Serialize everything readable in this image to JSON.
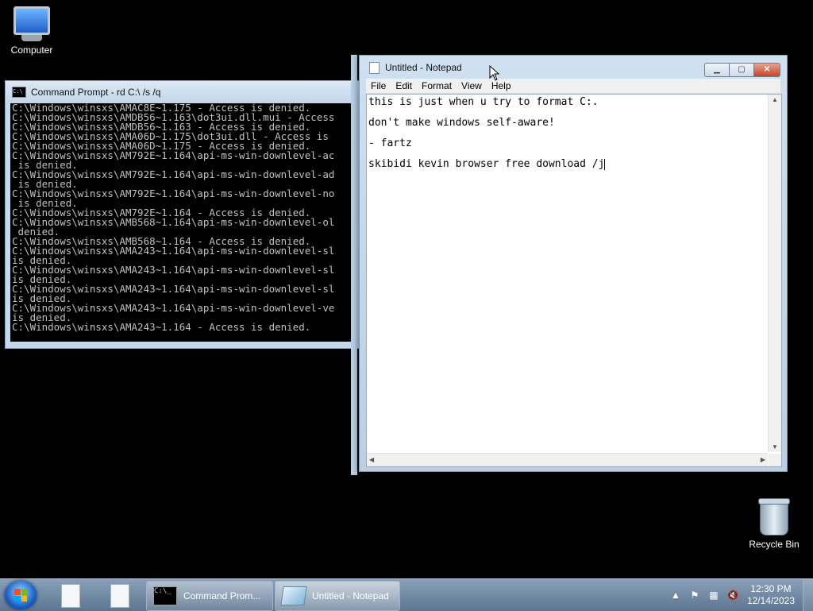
{
  "desktop": {
    "icons": [
      {
        "label": "Computer"
      },
      {
        "label": "Recycle Bin"
      }
    ]
  },
  "cmd": {
    "title": "Command Prompt - rd  C:\\ /s /q",
    "lines": [
      "C:\\Windows\\winsxs\\AMAC8E~1.175 - Access is denied.",
      "C:\\Windows\\winsxs\\AMDB56~1.163\\dot3ui.dll.mui - Access",
      "C:\\Windows\\winsxs\\AMDB56~1.163 - Access is denied.",
      "C:\\Windows\\winsxs\\AMA06D~1.175\\dot3ui.dll - Access is",
      "C:\\Windows\\winsxs\\AMA06D~1.175 - Access is denied.",
      "C:\\Windows\\winsxs\\AM792E~1.164\\api-ms-win-downlevel-ac",
      " is denied.",
      "C:\\Windows\\winsxs\\AM792E~1.164\\api-ms-win-downlevel-ad",
      " is denied.",
      "C:\\Windows\\winsxs\\AM792E~1.164\\api-ms-win-downlevel-no",
      " is denied.",
      "C:\\Windows\\winsxs\\AM792E~1.164 - Access is denied.",
      "C:\\Windows\\winsxs\\AMB568~1.164\\api-ms-win-downlevel-ol",
      " denied.",
      "C:\\Windows\\winsxs\\AMB568~1.164 - Access is denied.",
      "C:\\Windows\\winsxs\\AMA243~1.164\\api-ms-win-downlevel-sl",
      "is denied.",
      "C:\\Windows\\winsxs\\AMA243~1.164\\api-ms-win-downlevel-sl",
      "is denied.",
      "C:\\Windows\\winsxs\\AMA243~1.164\\api-ms-win-downlevel-sl",
      "is denied.",
      "C:\\Windows\\winsxs\\AMA243~1.164\\api-ms-win-downlevel-ve",
      "is denied.",
      "C:\\Windows\\winsxs\\AMA243~1.164 - Access is denied."
    ]
  },
  "notepad": {
    "title": "Untitled - Notepad",
    "menu": [
      "File",
      "Edit",
      "Format",
      "View",
      "Help"
    ],
    "lines": [
      "this is just when u try to format C:.",
      "don't make windows self-aware!",
      "- fartz",
      "skibidi kevin browser free download /j"
    ]
  },
  "taskbar": {
    "buttons": [
      {
        "label": "Command Prom...",
        "icon": "cmd-icon"
      },
      {
        "label": "Untitled - Notepad",
        "icon": "notepad-icon"
      }
    ],
    "clock": {
      "time": "12:30 PM",
      "date": "12/14/2023"
    }
  }
}
